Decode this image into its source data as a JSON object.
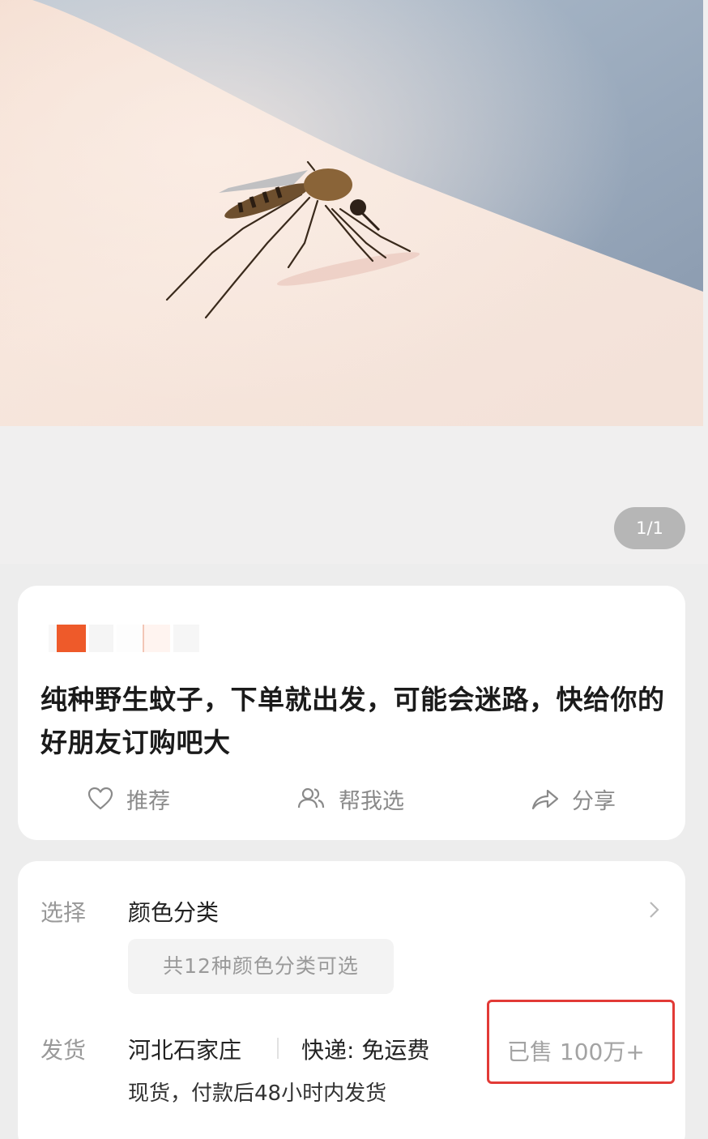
{
  "gallery": {
    "image_subject": "mosquito-on-skin-photo",
    "page_indicator": "1/1"
  },
  "product": {
    "title": "纯种野生蚊子，下单就出发，可能会迷路，快给你的好朋友订购吧大",
    "shop_badge_color": "#ee5a2a",
    "actions": [
      {
        "label": "推荐",
        "icon": "heart-icon"
      },
      {
        "label": "帮我选",
        "icon": "people-icon"
      },
      {
        "label": "分享",
        "icon": "share-arrow-icon"
      }
    ]
  },
  "options": {
    "select_label": "选择",
    "select_value": "颜色分类",
    "chip_text": "共12种颜色分类可选"
  },
  "shipping": {
    "label": "发货",
    "location": "河北石家庄",
    "delivery": "快递: 免运费",
    "stock_note": "现货，付款后48小时内发货",
    "sold": "已售  100万+"
  },
  "colors": {
    "highlight": "#e23a36",
    "muted_text": "#999999"
  }
}
